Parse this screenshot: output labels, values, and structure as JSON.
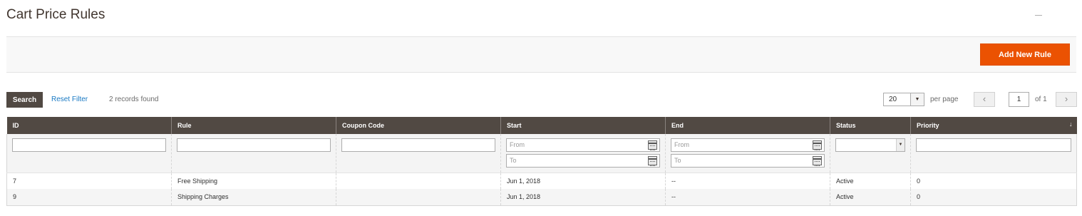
{
  "page": {
    "title": "Cart Price Rules"
  },
  "actions": {
    "add_label": "Add New Rule",
    "accent": "#eb5202"
  },
  "toolbar": {
    "search_label": "Search",
    "reset_label": "Reset Filter",
    "records_text": "2 records found",
    "page_size": "20",
    "per_page_label": "per page",
    "prev_icon": "‹",
    "next_icon": "›",
    "current_page": "1",
    "of_label": "of 1"
  },
  "grid": {
    "columns": [
      "ID",
      "Rule",
      "Coupon Code",
      "Start",
      "End",
      "Status",
      "Priority"
    ],
    "sort_icon": "↓",
    "header_color": "#514943",
    "filters": {
      "from_placeholder": "From",
      "to_placeholder": "To"
    },
    "rows": [
      {
        "id": "7",
        "rule": "Free Shipping",
        "coupon": "",
        "start": "Jun 1, 2018",
        "end": "--",
        "status": "Active",
        "priority": "0"
      },
      {
        "id": "9",
        "rule": "Shipping Charges",
        "coupon": "",
        "start": "Jun 1, 2018",
        "end": "--",
        "status": "Active",
        "priority": "0"
      }
    ]
  },
  "icons": {
    "calendar": "calendar-icon",
    "dropdown": "chevron-down-icon"
  }
}
